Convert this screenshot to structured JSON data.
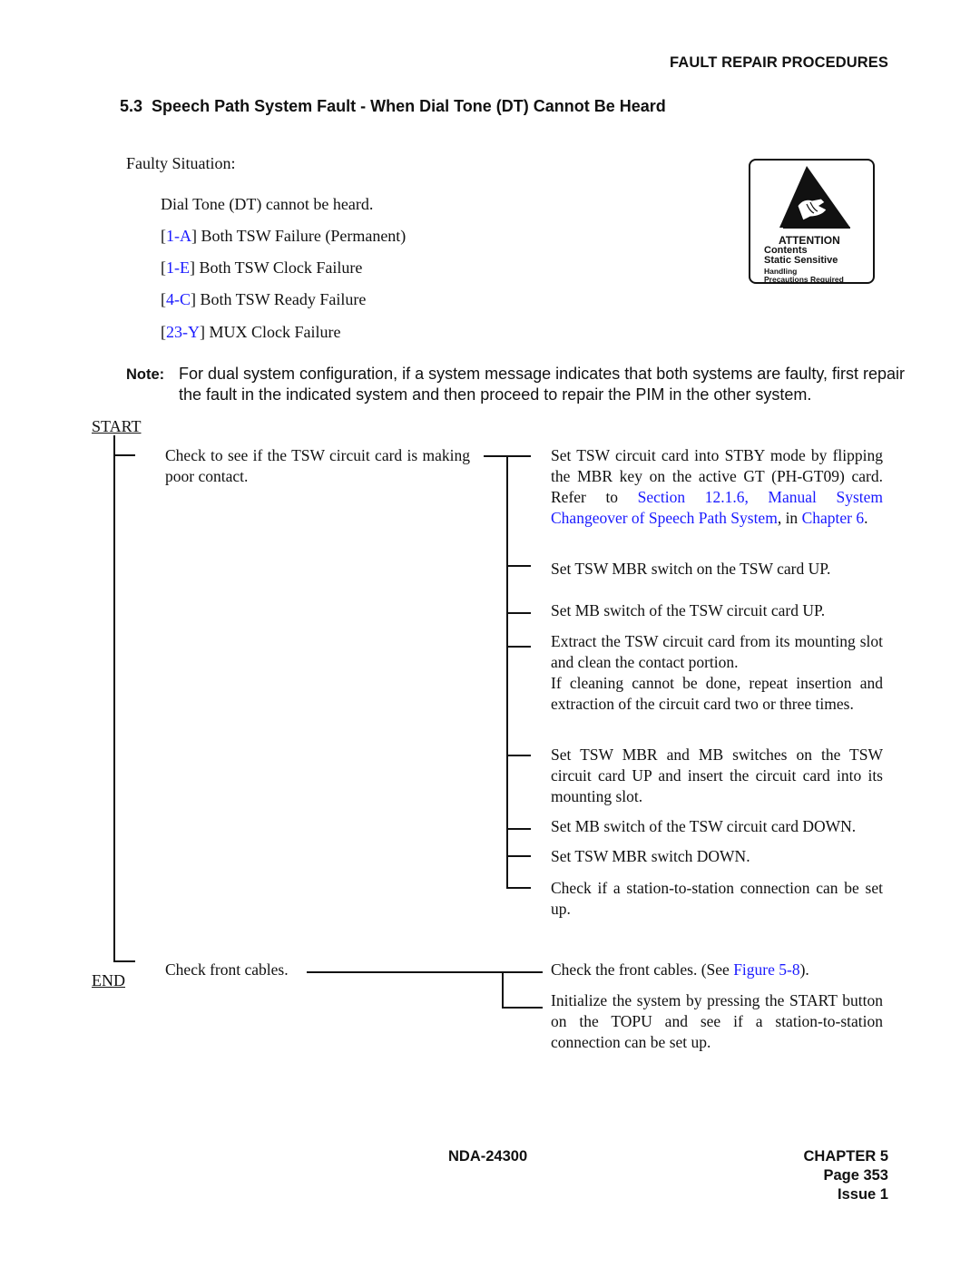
{
  "header": {
    "running_title": "FAULT REPAIR PROCEDURES"
  },
  "section": {
    "number": "5.3",
    "title": "Speech Path System Fault - When Dial Tone (DT) Cannot Be Heard"
  },
  "faulty_situation": {
    "label": "Faulty Situation:",
    "description": "Dial Tone (DT) cannot be heard.",
    "items": [
      {
        "code": "1-A",
        "text": "Both TSW Failure (Permanent)"
      },
      {
        "code": "1-E",
        "text": "Both TSW Clock Failure"
      },
      {
        "code": "4-C",
        "text": "Both TSW Ready Failure"
      },
      {
        "code": "23-Y",
        "text": "MUX Clock Failure"
      }
    ]
  },
  "attention_label": {
    "icon": "esd-warning-icon",
    "title": "ATTENTION",
    "line1": "Contents",
    "line2": "Static Sensitive",
    "line3": "Handling",
    "line4": "Precautions Required"
  },
  "note": {
    "label": "Note:",
    "text_line1": "For dual system configuration, if a system message indicates that both systems are faulty, first repair",
    "text_line2": "the fault in the indicated system and then proceed to repair the PIM in the other system."
  },
  "flowchart": {
    "start_label": "START",
    "end_label": "END",
    "left_steps": [
      {
        "text": "Check to see if the TSW circuit card is making poor contact."
      },
      {
        "text": "Check front cables."
      }
    ],
    "right_steps_group1": [
      {
        "text_before": "Set TSW circuit card into STBY mode by flipping the MBR key on the active GT (PH-GT09) card. Refer to ",
        "link1": "Section 12.1.6, Manual System Changeover of Speech Path System",
        "text_mid": ", in ",
        "link2": "Chapter 6",
        "text_after": "."
      },
      {
        "text": "Set TSW MBR switch on the TSW card UP."
      },
      {
        "text": "Set MB switch of the TSW circuit card UP."
      },
      {
        "text": "Extract the TSW circuit card from its mounting slot and clean the contact portion.",
        "text2": "If cleaning cannot be done, repeat insertion and extraction of the circuit card two or three times."
      },
      {
        "text": "Set TSW MBR and MB switches on the TSW circuit card UP and insert the circuit card into its mounting slot."
      },
      {
        "text": "Set MB switch of the TSW circuit card DOWN."
      },
      {
        "text": "Set TSW MBR switch DOWN."
      },
      {
        "text": "Check if a station-to-station connection can be set up."
      }
    ],
    "right_steps_group2": [
      {
        "text_before": "Check the front cables. (See ",
        "link": "Figure 5-8",
        "text_after": ")."
      },
      {
        "text": "Initialize the system by pressing the START button on the TOPU and see if a station-to-station connection can be set up."
      }
    ]
  },
  "footer": {
    "doc_number": "NDA-24300",
    "chapter": "CHAPTER 5",
    "page": "Page 353",
    "issue": "Issue 1"
  }
}
